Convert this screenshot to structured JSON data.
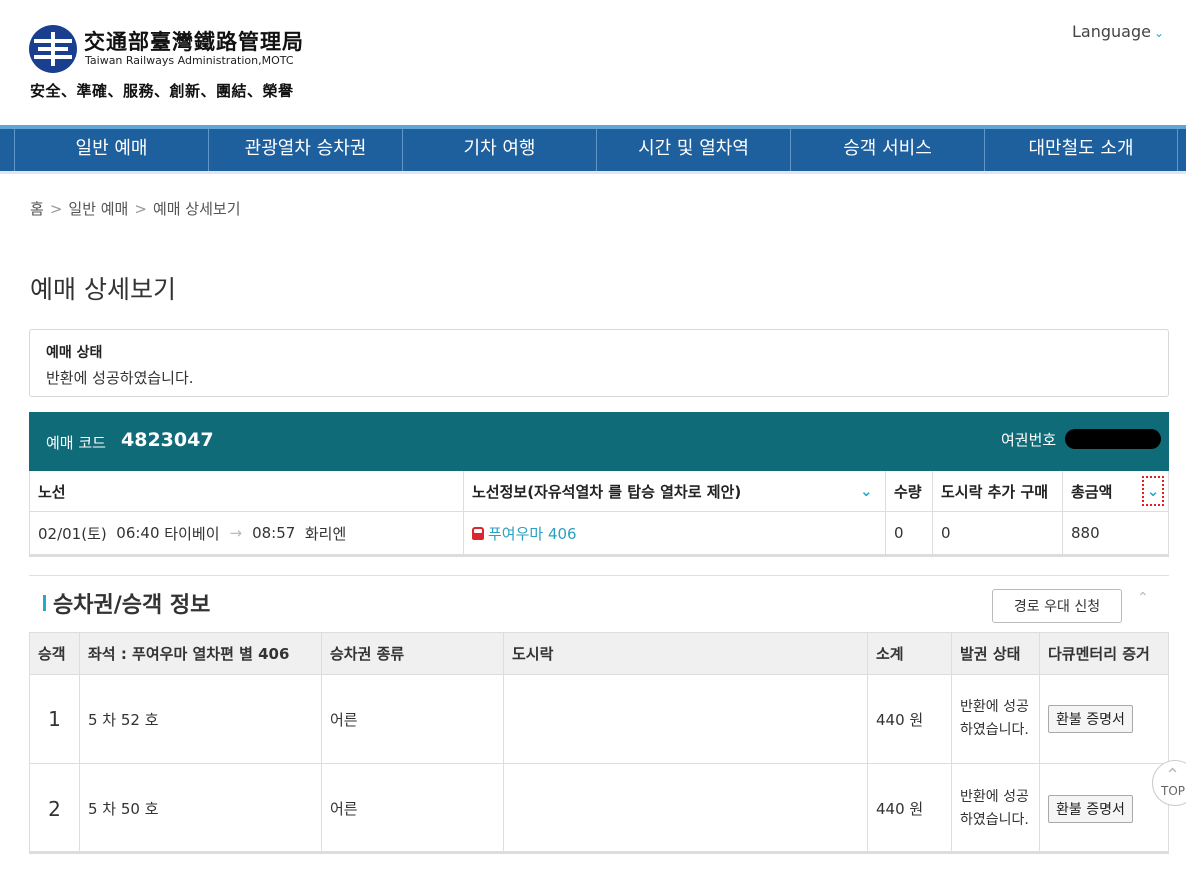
{
  "header": {
    "org_name_cn": "交通部臺灣鐵路管理局",
    "org_name_en": "Taiwan Railways Administration,MOTC",
    "slogan": "安全、準確、服務、創新、團結、榮譽",
    "language_label": "Language",
    "brand_color": "#1e5f9e"
  },
  "nav": {
    "items": [
      "일반 예매",
      "관광열차 승차권",
      "기차 여행",
      "시간 및 열차역",
      "승객 서비스",
      "대만철도 소개"
    ]
  },
  "breadcrumb": {
    "items": [
      "홈",
      "일반 예매",
      "예매 상세보기"
    ],
    "separator": ">"
  },
  "page_title": "예매 상세보기",
  "status": {
    "label": "예매 상태",
    "text": "반환에 성공하였습니다."
  },
  "booking": {
    "code_label": "예매 코드",
    "code": "4823047",
    "passport_label": "여권번호",
    "header_color": "#0f6b78",
    "columns": [
      "노선",
      "노선정보(자유석열차 를 탑승 열차로 제안)",
      "수량",
      "도시락 추가 구매",
      "총금액"
    ],
    "row": {
      "date": "02/01(토)",
      "dep_time": "06:40",
      "dep_station": "타이베이",
      "arrow": "→",
      "arr_time": "08:57",
      "arr_station": "화리엔",
      "train": "푸여우마 406",
      "quantity": "0",
      "bento": "0",
      "total": "880"
    }
  },
  "passengers": {
    "title": "승차권/승객 정보",
    "route_button": "경로 우대 신청",
    "columns": [
      "승객",
      "좌석 : 푸여우마 열차편 별 406",
      "승차권 종류",
      "도시락",
      "소계",
      "발권 상태",
      "다큐멘터리 증거"
    ],
    "rows": [
      {
        "no": "1",
        "seat": "5 차 52 호",
        "type": "어른",
        "bento": "",
        "subtotal": "440 원",
        "status": "반환에 성공하였습니다.",
        "doc_button": "환불 증명서"
      },
      {
        "no": "2",
        "seat": "5 차 50 호",
        "type": "어른",
        "bento": "",
        "subtotal": "440 원",
        "status": "반환에 성공하였습니다.",
        "doc_button": "환불 증명서"
      }
    ]
  },
  "top_button": "TOP"
}
